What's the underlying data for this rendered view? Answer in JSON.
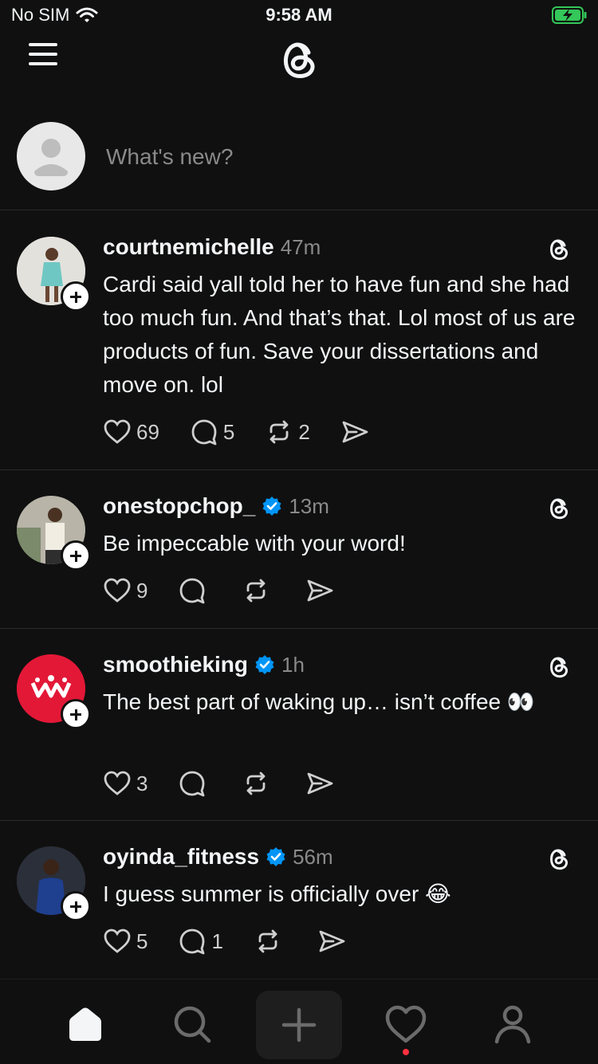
{
  "status_bar": {
    "carrier": "No SIM",
    "time": "9:58 AM",
    "battery": "charging"
  },
  "header": {
    "menu_icon": "hamburger-icon",
    "logo_icon": "threads-logo-icon"
  },
  "composer": {
    "placeholder": "What's new?"
  },
  "posts": [
    {
      "username": "courtnemichelle",
      "verified": false,
      "time": "47m",
      "text": "Cardi said yall told her to have fun and she had too much fun. And that’s that. Lol most of us are products of fun. Save your dissertations and move on. lol",
      "likes": "69",
      "replies": "5",
      "reposts": "2"
    },
    {
      "username": "onestopchop_",
      "verified": true,
      "time": "13m",
      "text": "Be impeccable with your word!",
      "likes": "9",
      "replies": "",
      "reposts": ""
    },
    {
      "username": "smoothieking",
      "verified": true,
      "time": "1h",
      "text": "The best part of waking up… isn’t coffee 👀",
      "likes": "3",
      "replies": "",
      "reposts": ""
    },
    {
      "username": "oyinda_fitness",
      "verified": true,
      "time": "56m",
      "text": "I guess summer is officially over 😂",
      "likes": "5",
      "replies": "1",
      "reposts": ""
    }
  ],
  "tab_bar": {
    "items": [
      "home-icon",
      "search-icon",
      "compose-icon",
      "activity-icon",
      "profile-icon"
    ],
    "activity_badge_color": "#ff3040"
  },
  "colors": {
    "background": "#101010",
    "verified": "#0095f6",
    "text": "#f3f5f7",
    "secondary": "#8a8a8a"
  }
}
